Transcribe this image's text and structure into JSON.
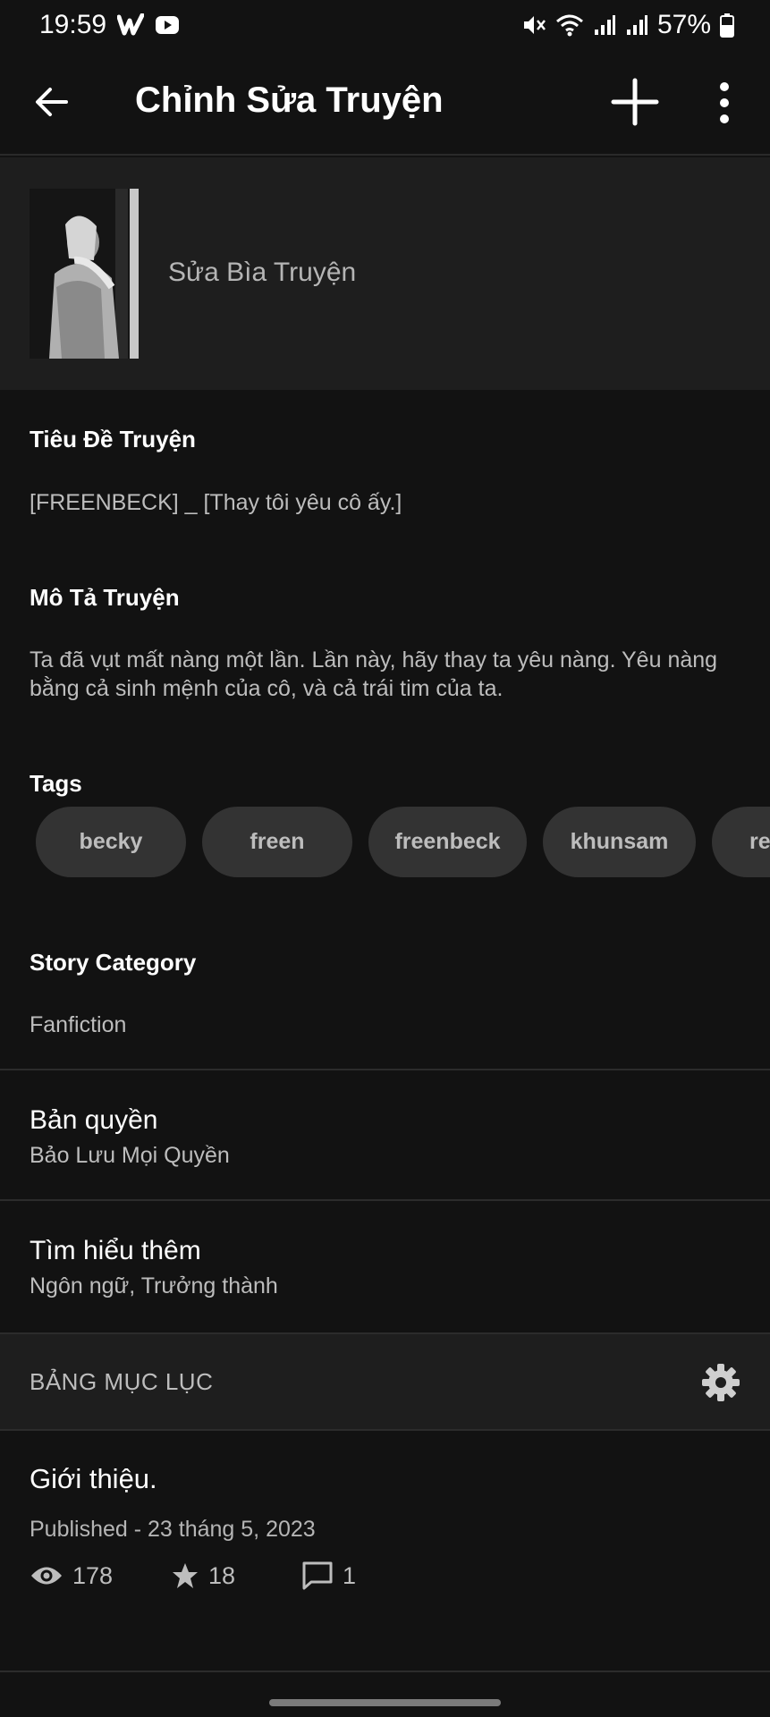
{
  "status_bar": {
    "time": "19:59",
    "battery": "57%"
  },
  "app_bar": {
    "title": "Chỉnh Sửa Truyện"
  },
  "cover": {
    "label": "Sửa Bìa Truyện"
  },
  "story_title": {
    "label": "Tiêu Đề Truyện",
    "value": "[FREENBECK] _ [Thay tôi yêu cô ấy.]"
  },
  "description": {
    "label": "Mô Tả Truyện",
    "value": "Ta đã vụt mất nàng một lần. Lần này, hãy thay ta yêu nàng. Yêu nàng bằng cả sinh mệnh của cô, và cả trái tim của ta."
  },
  "tags": {
    "label": "Tags",
    "items": [
      "becky",
      "freen",
      "freenbeck",
      "khunsam",
      "reb"
    ]
  },
  "category": {
    "label": "Story Category",
    "value": "Fanfiction"
  },
  "copyright": {
    "title": "Bản quyền",
    "value": "Bảo Lưu Mọi Quyền"
  },
  "learn_more": {
    "title": "Tìm hiểu thêm",
    "value": "Ngôn ngữ, Trưởng thành"
  },
  "toc": {
    "label": "BẢNG MỤC LỤC"
  },
  "chapter": {
    "title": "Giới thiệu.",
    "published": "Published - 23 tháng 5, 2023",
    "views": "178",
    "votes": "18",
    "comments": "1"
  }
}
